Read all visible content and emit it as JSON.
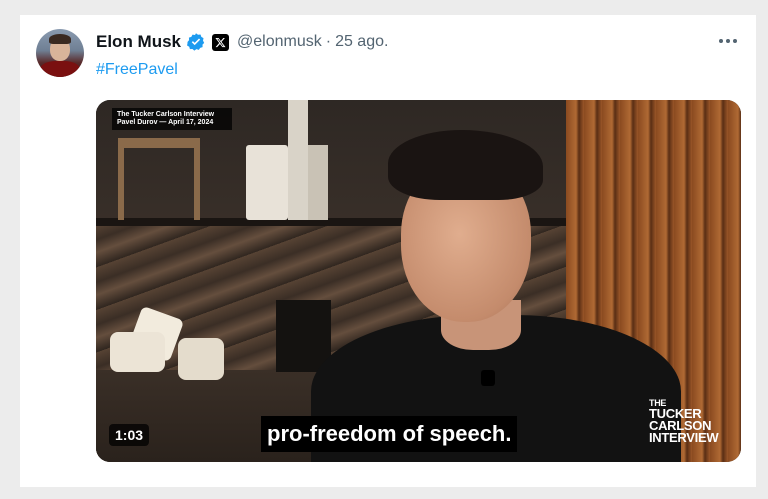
{
  "tweet": {
    "author_name": "Elon Musk",
    "handle": "@elonmusk",
    "separator": "·",
    "date": "25 ago.",
    "hashtag": "#FreePavel",
    "verified_icon": "verified-badge-icon",
    "platform_icon": "x-logo-icon",
    "more_icon": "more-options-icon"
  },
  "video": {
    "caption_overlay": "The Tucker Carlson Interview\nPavel Durov — April 17, 2024",
    "subtitle": "pro-freedom of speech.",
    "duration": "1:03",
    "logo_lines": [
      "THE",
      "TUCKER",
      "CARLSON",
      "INTERVIEW"
    ]
  },
  "colors": {
    "link": "#1d9bf0",
    "verified": "#1d9bf0",
    "secondary_text": "#536471",
    "primary_text": "#0f1419"
  }
}
